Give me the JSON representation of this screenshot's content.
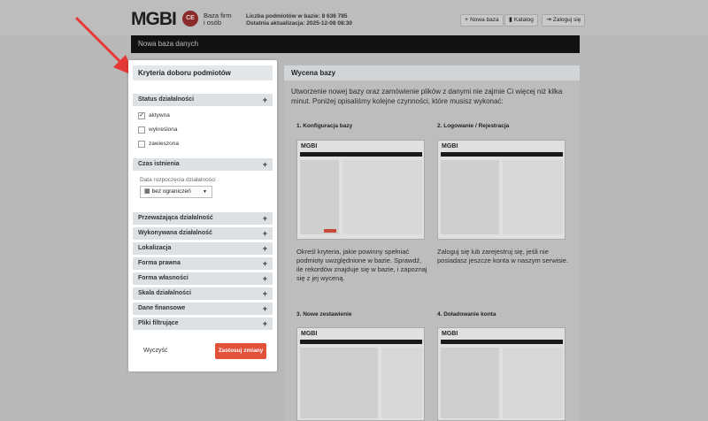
{
  "header": {
    "logo": "MGBI",
    "logo_badge": "CE",
    "logo_tagline_1": "Baza firm",
    "logo_tagline_2": "i osób",
    "stats_line_1": "Liczba podmiotów w bazie: 8 636 785",
    "stats_line_2": "Ostatnia aktualizacja: 2025-12-08 08:30",
    "btn_new_db": "Nowa baza",
    "btn_catalog": "Katalog",
    "btn_login": "Zaloguj się"
  },
  "darkbar": {
    "title": "Nowa baza danych"
  },
  "sidebar": {
    "title": "Kryteria doboru podmiotów",
    "status": {
      "label": "Status działalności",
      "options": [
        {
          "label": "aktywna",
          "checked": "✓"
        },
        {
          "label": "wykreślona",
          "checked": ""
        },
        {
          "label": "zawieszona",
          "checked": ""
        }
      ]
    },
    "czas": {
      "label": "Czas istnienia",
      "date_label": "Data rozpoczęcia działalności",
      "date_value": "bez ograniczeń"
    },
    "sections": [
      "Przeważająca działalność",
      "Wykonywana działalność",
      "Lokalizacja",
      "Forma prawna",
      "Forma własności",
      "Skala działalności",
      "Dane finansowe",
      "Pliki filtrujące"
    ],
    "btn_clear": "Wyczyść",
    "btn_apply": "Zastosuj zmiany"
  },
  "main": {
    "title": "Wycena bazy",
    "intro": "Utworzenie nowej bazy oraz zamówienie plików z danymi nie zajmie Ci więcej niż kilka minut. Poniżej opisaliśmy kolejne czynności, które musisz wykonać:",
    "steps": [
      {
        "title": "1. Konfiguracja bazy",
        "desc": "Określ kryteria, jakie powinny spełniać podmioty uwzględnione w bazie. Sprawdź, ile rekordów znajduje się w bazie, i zapoznaj się z jej wyceną."
      },
      {
        "title": "2. Logowanie / Rejestracja",
        "desc": "Zaloguj się lub zarejestruj się, jeśli nie posiadasz jeszcze konta w naszym serwisie."
      },
      {
        "title": "3. Nowe zestawienie",
        "desc": ""
      },
      {
        "title": "4. Doładowanie konta",
        "desc": ""
      }
    ],
    "thumb_logo": "MGBI"
  },
  "colors": {
    "accent": "#e2513a",
    "arrow": "#e53935",
    "darkbar": "#121212"
  }
}
